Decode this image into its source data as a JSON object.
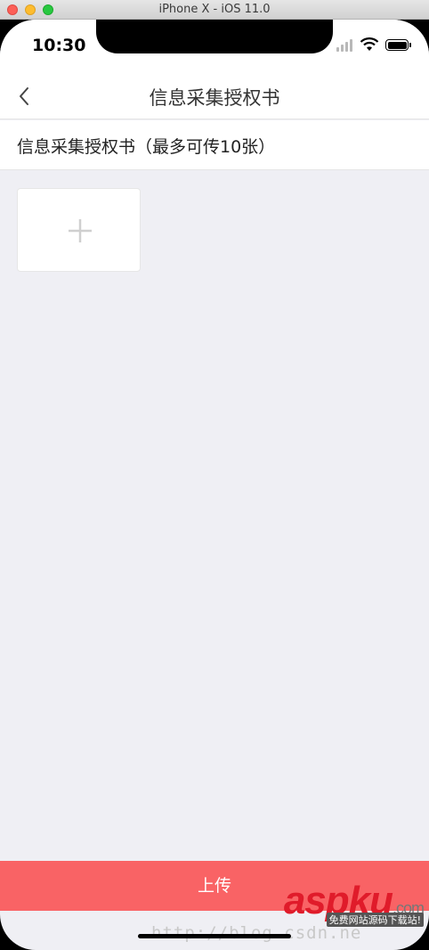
{
  "window": {
    "title": "iPhone X - iOS 11.0"
  },
  "status_bar": {
    "time": "10:30"
  },
  "nav": {
    "title": "信息采集授权书"
  },
  "section": {
    "header": "信息采集授权书（最多可传10张）"
  },
  "upload_button": {
    "label": "上传"
  },
  "colors": {
    "accent": "#f96365",
    "background": "#efeff4"
  },
  "icons": [
    "back-chevron-icon",
    "plus-icon",
    "signal-icon",
    "wifi-icon",
    "battery-icon"
  ],
  "watermark": {
    "text": "http://blog.csdn.ne"
  },
  "logo": {
    "main": "aspku",
    "suffix": ".com",
    "tagline": "免费网站源码下载站!"
  }
}
